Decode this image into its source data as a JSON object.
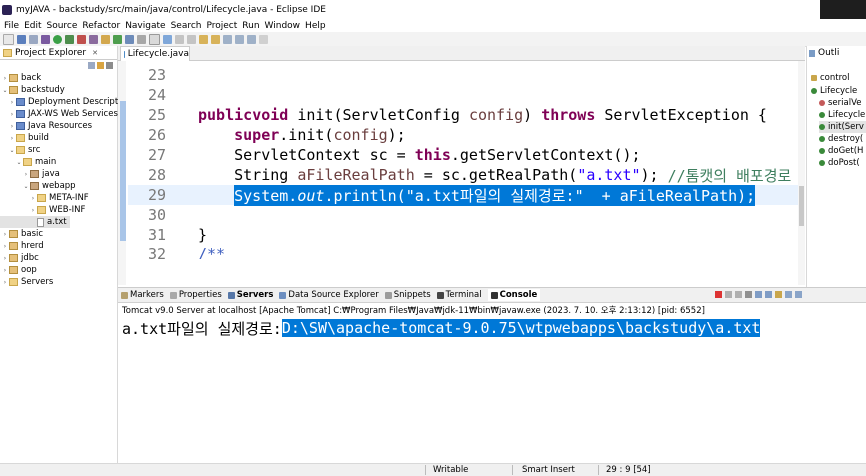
{
  "window": {
    "title": "myJAVA - backstudy/src/main/java/control/Lifecycle.java - Eclipse IDE"
  },
  "menu": [
    "File",
    "Edit",
    "Source",
    "Refactor",
    "Navigate",
    "Search",
    "Project",
    "Run",
    "Window",
    "Help"
  ],
  "project_explorer": {
    "tab_label": "Project Explorer",
    "tab_close": "✕",
    "items": [
      {
        "label": "back",
        "arrow": "›",
        "icon": "project"
      },
      {
        "label": "backstudy",
        "arrow": "⌄",
        "icon": "project"
      },
      {
        "label": "Deployment Descriptor:",
        "arrow": "›",
        "icon": "misc"
      },
      {
        "label": "JAX-WS Web Services",
        "arrow": "›",
        "icon": "misc"
      },
      {
        "label": "Java Resources",
        "arrow": "›",
        "icon": "misc"
      },
      {
        "label": "build",
        "arrow": "›",
        "icon": "folder"
      },
      {
        "label": "src",
        "arrow": "⌄",
        "icon": "folder"
      },
      {
        "label": "main",
        "arrow": "⌄",
        "icon": "folder"
      },
      {
        "label": "java",
        "arrow": "›",
        "icon": "srcfolder"
      },
      {
        "label": "webapp",
        "arrow": "⌄",
        "icon": "srcfolder"
      },
      {
        "label": "META-INF",
        "arrow": "›",
        "icon": "folder"
      },
      {
        "label": "WEB-INF",
        "arrow": "›",
        "icon": "folder"
      },
      {
        "label": "a.txt",
        "arrow": "",
        "icon": "file"
      },
      {
        "label": "basic",
        "arrow": "›",
        "icon": "project"
      },
      {
        "label": "hrerd",
        "arrow": "›",
        "icon": "project"
      },
      {
        "label": "jdbc",
        "arrow": "›",
        "icon": "project"
      },
      {
        "label": "oop",
        "arrow": "›",
        "icon": "project"
      },
      {
        "label": "Servers",
        "arrow": "›",
        "icon": "folder"
      }
    ]
  },
  "editor": {
    "tab_label": "Lifecycle.java",
    "lines": [
      {
        "num": "23",
        "code": ""
      },
      {
        "num": "24",
        "code": ""
      },
      {
        "num": "25",
        "code": "public void init(ServletConfig config) throws ServletException {"
      },
      {
        "num": "26",
        "code": "super.init(config);"
      },
      {
        "num": "27",
        "code": "ServletContext sc = this.getServletContext();"
      },
      {
        "num": "28",
        "code": "String aFileRealPath = sc.getRealPath(\"a.txt\"); //톰캣의 배포경로"
      },
      {
        "num": "29",
        "code": "System.out.println(\"a.txt파일의 실제경로:\"  + aFileRealPath);"
      },
      {
        "num": "30",
        "code": ""
      },
      {
        "num": "31",
        "code": "}"
      },
      {
        "num": "32",
        "code": "/**"
      }
    ],
    "t": {
      "kw_public": "public",
      "kw_void": "void",
      "init": " init(",
      "ServletConfig": "ServletConfig ",
      "config": "config",
      "throws_pre": ") ",
      "kw_throws": "throws",
      "ServletException": " ServletException {",
      "kw_super": "super",
      "super_rest": ".init(",
      "super_cfg": "config",
      "super_end": ");",
      "sc_pre": "ServletContext sc = ",
      "kw_this": "this",
      "sc_post": ".getServletContext();",
      "s_pre": "String ",
      "s_var": "aFileRealPath",
      "s_mid": " = sc.getRealPath(",
      "s_str": "\"a.txt\"",
      "s_end": "); ",
      "s_cmt": "//톰캣의 배포경로",
      "p_sys": "System.",
      "p_out": "out",
      "p_mid": ".println(",
      "p_str": "\"a.txt파일의 실제경로:\"",
      "p_end": "  + aFileRealPath);",
      "closebrace": "}",
      "doc": "/**"
    }
  },
  "outline": {
    "tab_label": "Outli",
    "items": [
      "control",
      "Lifecycle",
      "serialVe",
      "Lifecycle",
      "init(Serv",
      "destroy(",
      "doGet(H",
      "doPost("
    ]
  },
  "console": {
    "tabs": [
      "Markers",
      "Properties",
      "Servers",
      "Data Source Explorer",
      "Snippets",
      "Terminal",
      "Console"
    ],
    "active_tab": "Console",
    "header": "Tomcat v9.0 Server at localhost [Apache Tomcat] C:₩Program Files₩Java₩jdk-11₩bin₩javaw.exe  (2023. 7. 10. 오후 2:13:12) [pid: 6552]",
    "output_label": "a.txt파일의 실제경로:",
    "output_path": "D:\\SW\\apache-tomcat-9.0.75\\wtpwebapps\\backstudy\\a.txt"
  },
  "status": {
    "writable": "Writable",
    "insert": "Smart Insert",
    "position": "29 : 9 [54]"
  },
  "colors": {
    "selection": "#0078d7",
    "keyword": "#7f0055",
    "string": "#2a00ff",
    "comment": "#3f7f5f"
  }
}
